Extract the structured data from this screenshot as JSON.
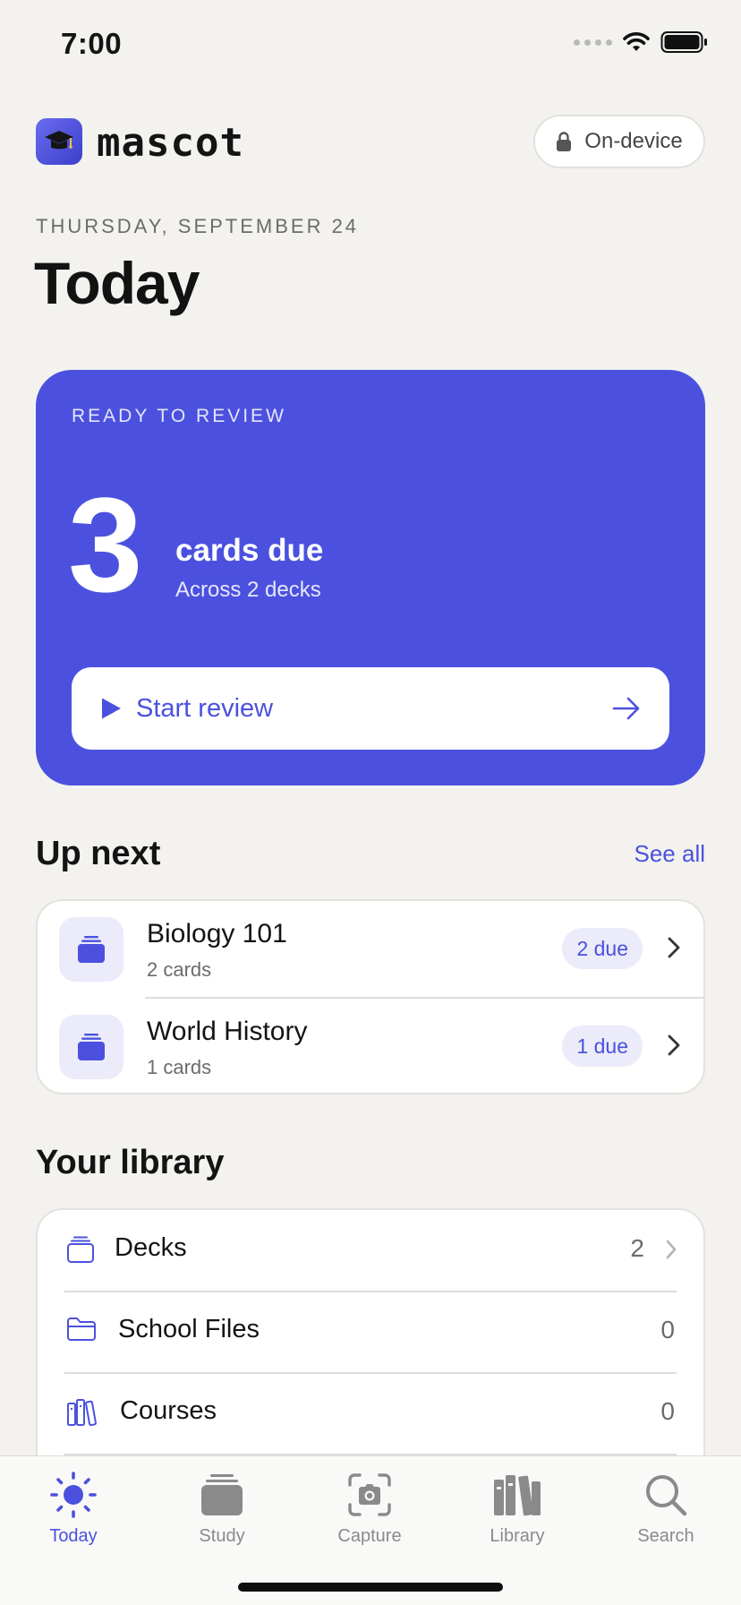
{
  "status_bar": {
    "time": "7:00"
  },
  "header": {
    "app_name": "mascot",
    "privacy_label": "On-device"
  },
  "date_label": "THURSDAY, SEPTEMBER 24",
  "page_title": "Today",
  "review": {
    "kicker": "READY TO REVIEW",
    "count": "3",
    "title": "cards due",
    "subtitle": "Across 2 decks",
    "start_label": "Start review"
  },
  "up_next": {
    "title": "Up next",
    "see_all": "See all",
    "items": [
      {
        "name": "Biology 101",
        "cards": "2 cards",
        "due": "2 due"
      },
      {
        "name": "World History",
        "cards": "1 cards",
        "due": "1 due"
      }
    ]
  },
  "library": {
    "title": "Your library",
    "items": [
      {
        "label": "Decks",
        "count": "2",
        "icon": "decks-icon"
      },
      {
        "label": "School Files",
        "count": "0",
        "icon": "folder-icon"
      },
      {
        "label": "Courses",
        "count": "0",
        "icon": "books-icon"
      }
    ]
  },
  "tabs": [
    {
      "label": "Today",
      "icon": "sun-icon",
      "active": true
    },
    {
      "label": "Study",
      "icon": "cards-stack-icon",
      "active": false
    },
    {
      "label": "Capture",
      "icon": "camera-icon",
      "active": false
    },
    {
      "label": "Library",
      "icon": "library-icon",
      "active": false
    },
    {
      "label": "Search",
      "icon": "search-icon",
      "active": false
    }
  ],
  "colors": {
    "accent": "#4b51de",
    "accent_soft": "#ebebfa",
    "background": "#f3f2ef",
    "text": "#141414",
    "muted": "#6b6b6b"
  }
}
